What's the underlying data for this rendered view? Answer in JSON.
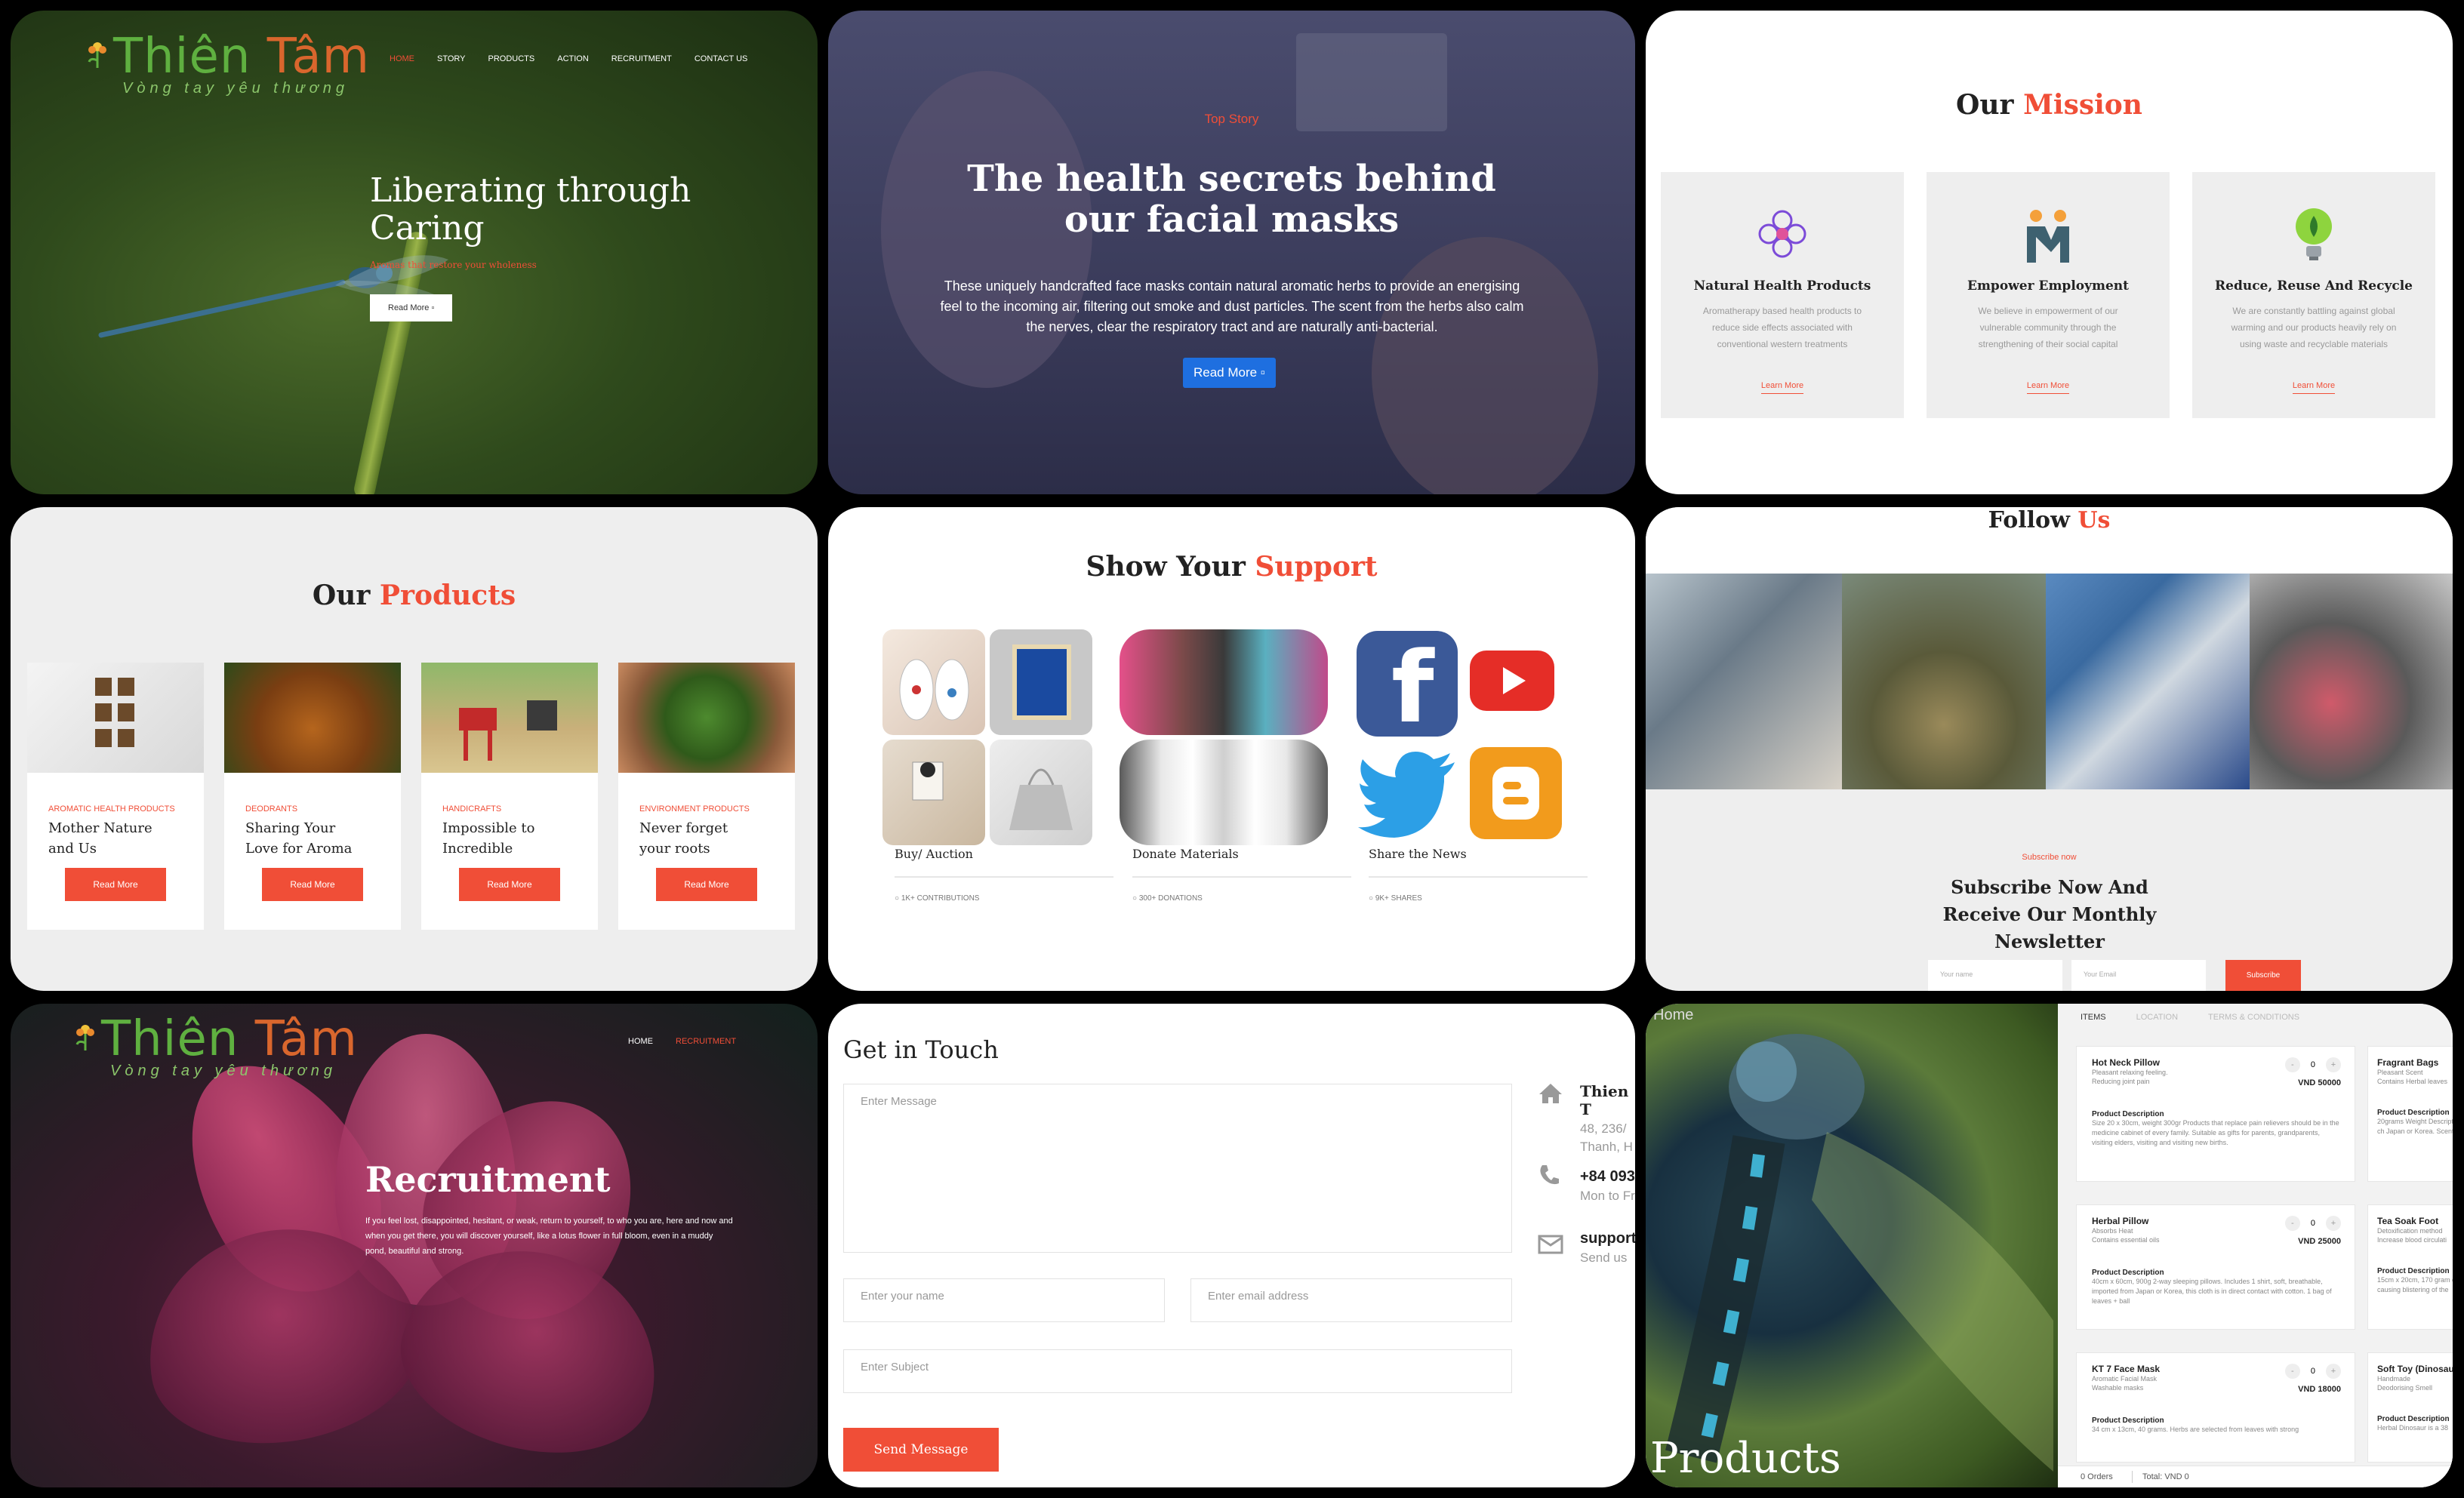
{
  "colors": {
    "accent": "#f04e37",
    "blue_button": "#1e6fe0",
    "green": "#5fb040",
    "orange": "#d9662d"
  },
  "logo": {
    "name_a": "Thiên ",
    "name_b": "Tâm",
    "tagline": "Vòng tay yêu thương"
  },
  "tile1": {
    "nav": [
      "HOME",
      "STORY",
      "PRODUCTS",
      "ACTION",
      "RECRUITMENT",
      "CONTACT US"
    ],
    "title": "Liberating through Caring",
    "subtitle": "Aromas that restore your wholeness",
    "button": "Read More",
    "button_icon": "arrow-icon"
  },
  "tile2": {
    "label": "Top Story",
    "title": "The health secrets behind our facial masks",
    "text": "These uniquely handcrafted face masks contain natural aromatic herbs to provide an energising feel to the incoming air, filtering out smoke and dust particles. The scent from the herbs also calm the nerves, clear the respiratory tract and are naturally anti-bacterial.",
    "button": "Read More"
  },
  "tile3": {
    "title_a": "Our ",
    "title_b": "Mission",
    "cards": [
      {
        "title": "Natural Health Products",
        "text": "Aromatherapy based health products to reduce side effects associated with conventional western treatments",
        "link": "Learn More",
        "icon": "flower-icon"
      },
      {
        "title": "Empower Employment",
        "text": "We believe in empowerment of our vulnerable community through the strengthening of their social capital",
        "link": "Learn More",
        "icon": "people-icon"
      },
      {
        "title": "Reduce, Reuse And Recycle",
        "text": "We are constantly battling against global warming and our products heavily rely on using waste and recyclable materials",
        "link": "Learn More",
        "icon": "lightbulb-icon"
      }
    ]
  },
  "tile4": {
    "title_a": "Our ",
    "title_b": "Products",
    "cards": [
      {
        "category": "AROMATIC HEALTH PRODUCTS",
        "name": "Mother Nature and Us",
        "button": "Read More"
      },
      {
        "category": "DEODRANTS",
        "name": "Sharing Your Love for Aroma",
        "button": "Read More"
      },
      {
        "category": "HANDICRAFTS",
        "name": "Impossible to Incredible",
        "button": "Read More"
      },
      {
        "category": "ENVIRONMENT PRODUCTS",
        "name": "Never forget your roots",
        "button": "Read More"
      }
    ]
  },
  "tile5": {
    "title_a": "Show Your ",
    "title_b": "Support",
    "columns": [
      {
        "label": "Buy/ Auction",
        "meta": "1K+ CONTRIBUTIONS"
      },
      {
        "label": "Donate Materials",
        "meta": "300+ DONATIONS"
      },
      {
        "label": "Share the News",
        "meta": "9K+ SHARES"
      }
    ],
    "social_icons": [
      "facebook-icon",
      "youtube-icon",
      "twitter-icon",
      "blogger-icon"
    ]
  },
  "tile6": {
    "title_a": "Follow ",
    "title_b": "Us",
    "label": "Subscribe now",
    "title": "Subscribe Now And Receive Our Monthly Newsletter",
    "name_placeholder": "Your name",
    "email_placeholder": "Your Email",
    "button": "Subscribe"
  },
  "tile7": {
    "nav": [
      "HOME",
      "RECRUITMENT"
    ],
    "title": "Recruitment",
    "text": "If you feel lost, disappointed, hesitant, or weak, return to yourself, to who you are, here and now and when you get there, you will discover yourself, like a lotus flower in full bloom, even in a muddy pond, beautiful and strong."
  },
  "tile8": {
    "title": "Get in Touch",
    "message_placeholder": "Enter Message",
    "name_placeholder": "Enter your name",
    "email_placeholder": "Enter email address",
    "subject_placeholder": "Enter Subject",
    "button": "Send Message",
    "contact": [
      {
        "icon": "home-icon",
        "title": "Thien T",
        "sub": "48, 236/",
        "sub2": "Thanh, H"
      },
      {
        "icon": "phone-icon",
        "title": "+84 093",
        "sub": "Mon to Fr"
      },
      {
        "icon": "mail-icon",
        "title": "support",
        "sub": "Send us"
      }
    ]
  },
  "tile9": {
    "corner": "Home",
    "overlay_title": "Products",
    "tabs": [
      "ITEMS",
      "LOCATION",
      "TERMS & CONDITIONS"
    ],
    "items": [
      {
        "name": "Hot Neck Pillow",
        "desc1": "Pleasant relaxing feeling.",
        "desc2": "Reducing joint pain",
        "qty": "0",
        "price": "VND 50000",
        "detail_head": "Product Description",
        "detail": "Size 20 x 30cm, weight 300gr Products that replace pain relievers should be in the medicine cabinet of every family. Suitable as gifts for parents, grandparents, visiting elders, visiting and visiting new births."
      },
      {
        "name": "Herbal Pillow",
        "desc1": "Absorbs Heat",
        "desc2": "Contains essential oils",
        "qty": "0",
        "price": "VND 25000",
        "detail_head": "Product Description",
        "detail": "40cm x 60cm, 900g 2-way sleeping pillows. Includes 1 shirt, soft, breathable, imported from Japan or Korea, this cloth is in direct contact with cotton. 1 bag of leaves + ball"
      },
      {
        "name": "KT 7 Face Mask",
        "desc1": "Aromatic Facial Mask",
        "desc2": "Washable masks",
        "qty": "0",
        "price": "VND 18000",
        "detail_head": "Product Description",
        "detail": "34 cm x 13cm, 40 grams. Herbs are selected from leaves with strong"
      }
    ],
    "side_items": [
      {
        "name": "Fragrant Bags",
        "desc1": "Pleasant Scent",
        "desc2": "Contains Herbal leaves",
        "detail_head": "Product Description",
        "detail": "20grams Weight Description and dried leaves The ch Japan or Korea. Scent manufacture."
      },
      {
        "name": "Tea Soak Foot",
        "desc1": "Detoxification method",
        "desc2": "Increase blood circulati",
        "detail_head": "Product Description",
        "detail": "15cm x 20cm, 170 gram excretion. Regulates blo causing blistering of the"
      },
      {
        "name": "Soft Toy (Dinosaur)",
        "desc1": "Handmade",
        "desc2": "Deodorising Smell",
        "detail_head": "Product Description",
        "detail": "Herbal Dinosaur is a 38"
      }
    ],
    "footer_orders": "0 Orders",
    "footer_total": "Total: VND 0"
  }
}
